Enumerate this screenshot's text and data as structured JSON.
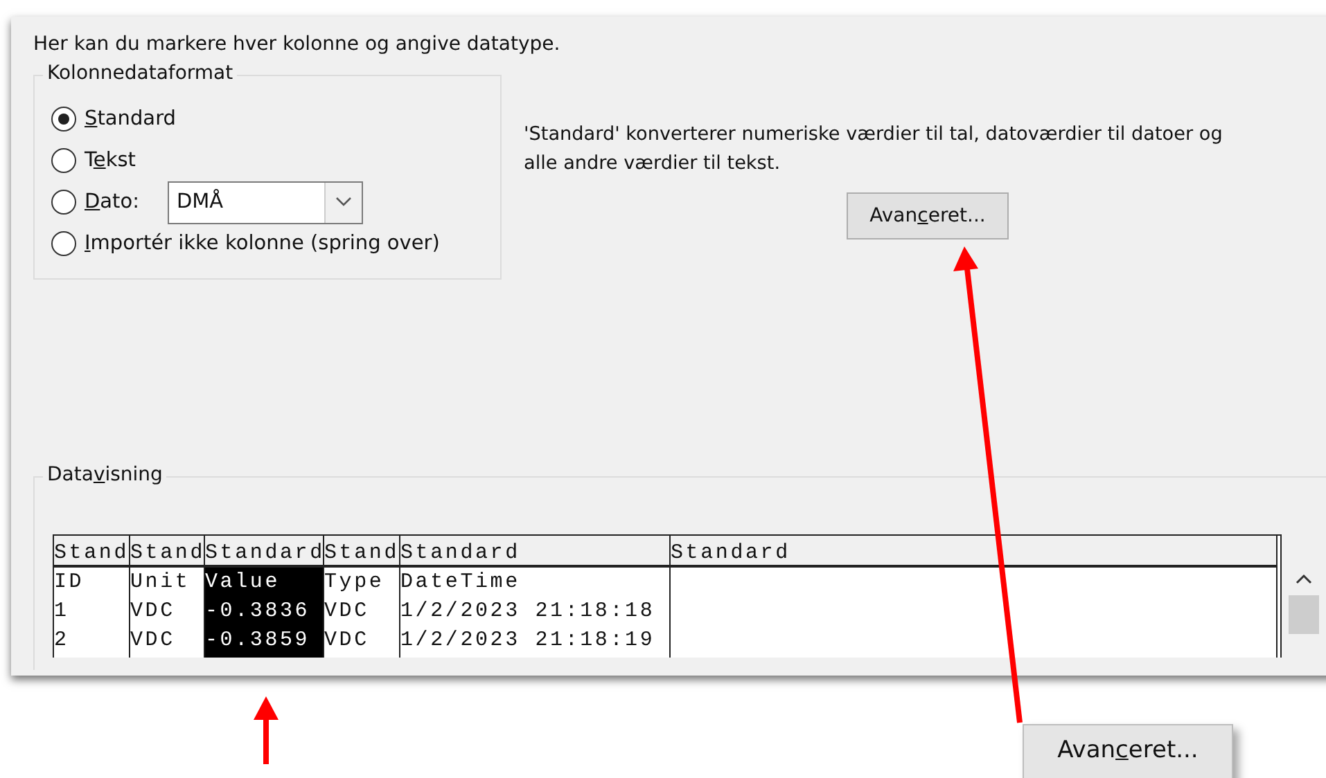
{
  "instruction": "Her kan du markere hver kolonne og angive datatype.",
  "format_group": {
    "title": "Kolonnedataformat",
    "options": [
      {
        "key": "S",
        "after": "tandard",
        "selected": true
      },
      {
        "before": "T",
        "key": "e",
        "after": "kst",
        "selected": false
      },
      {
        "key": "D",
        "after": "ato:",
        "selected": false,
        "combo": {
          "value": "DMÅ"
        }
      },
      {
        "key": "I",
        "after": "mportér ikke kolonne (spring over)",
        "selected": false
      }
    ]
  },
  "description": [
    "'Standard' konverterer numeriske værdier til tal, datoværdier til datoer og",
    "alle andre værdier til tekst."
  ],
  "advanced_button": {
    "before": "Avan",
    "key": "c",
    "after": "eret..."
  },
  "preview_group": {
    "title_before": "Data",
    "title_key": "v",
    "title_after": "isning",
    "columns": [
      {
        "header": "Stand",
        "selected": false
      },
      {
        "header": "Stand",
        "selected": false
      },
      {
        "header": "Standard",
        "selected": true
      },
      {
        "header": "Stand",
        "selected": false
      },
      {
        "header": "Standard",
        "selected": false
      },
      {
        "header": "Standard",
        "selected": false
      }
    ],
    "rows": [
      [
        "ID",
        "Unit",
        "Value",
        "Type",
        "DateTime"
      ],
      [
        "1",
        "VDC",
        "-0.3836",
        "VDC",
        "1/2/2023 21:18:18"
      ],
      [
        "2",
        "VDC",
        "-0.3859",
        "VDC",
        "1/2/2023 21:18:19"
      ]
    ]
  },
  "callout_button": {
    "before": "Avan",
    "key": "c",
    "after": "eret..."
  }
}
